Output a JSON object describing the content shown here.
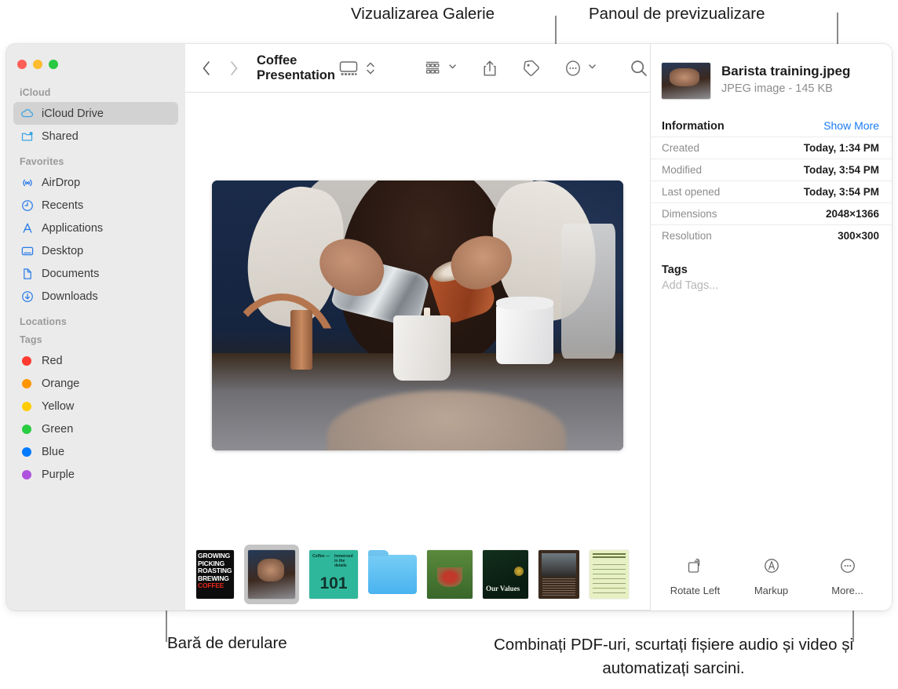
{
  "callouts": {
    "gallery_view": "Vizualizarea Galerie",
    "preview_panel": "Panoul de previzualizare",
    "scrollbar": "Bară de derulare",
    "more_actions": "Combinați PDF-uri, scurtați fișiere audio și video și automatizați sarcini."
  },
  "window": {
    "traffic_lights": [
      "close",
      "minimize",
      "zoom"
    ],
    "colors": {
      "close": "#ff5f57",
      "minimize": "#febc2e",
      "zoom": "#28c840",
      "accent": "#1a7cf5",
      "sidebar_bg": "#ebebeb",
      "selection": "#d2d2d2"
    }
  },
  "toolbar": {
    "back_label": "Back",
    "forward_label": "Forward",
    "title": "Coffee Presentation",
    "view_button": "gallery-view",
    "view_stepper": "view-options",
    "group_button": "group-by",
    "share_button": "Share",
    "tag_button": "Tags",
    "more_button": "More",
    "search_button": "Search"
  },
  "sidebar": {
    "sections": [
      {
        "label": "iCloud",
        "items": [
          {
            "label": "iCloud Drive",
            "icon": "cloud-icon",
            "selected": true
          },
          {
            "label": "Shared",
            "icon": "shared-folder-icon",
            "selected": false
          }
        ]
      },
      {
        "label": "Favorites",
        "items": [
          {
            "label": "AirDrop",
            "icon": "airdrop-icon",
            "selected": false
          },
          {
            "label": "Recents",
            "icon": "clock-icon",
            "selected": false
          },
          {
            "label": "Applications",
            "icon": "applications-icon",
            "selected": false
          },
          {
            "label": "Desktop",
            "icon": "desktop-icon",
            "selected": false
          },
          {
            "label": "Documents",
            "icon": "document-icon",
            "selected": false
          },
          {
            "label": "Downloads",
            "icon": "downloads-icon",
            "selected": false
          }
        ]
      },
      {
        "label": "Locations",
        "items": []
      },
      {
        "label": "Tags",
        "items": [
          {
            "label": "Red",
            "color": "#ff3b30"
          },
          {
            "label": "Orange",
            "color": "#ff9500"
          },
          {
            "label": "Yellow",
            "color": "#ffcc00"
          },
          {
            "label": "Green",
            "color": "#28cd41"
          },
          {
            "label": "Blue",
            "color": "#007aff"
          },
          {
            "label": "Purple",
            "color": "#af52de"
          }
        ]
      }
    ]
  },
  "gallery": {
    "hero_alt": "Barista pouring steamed milk and coffee into a to-go cup",
    "thumbnails": [
      {
        "name": "Growing Picking Roasting Brewing Coffee",
        "lines": [
          "GROWING",
          "PICKING",
          "ROASTING",
          "BREWING"
        ],
        "accent_line": "COFFEE",
        "selected": false
      },
      {
        "name": "Barista training.jpeg",
        "selected": true
      },
      {
        "name": "Coffee 101",
        "big_text": "101",
        "small_left": "Coffee —",
        "small_right": "Immersed in the details",
        "selected": false
      },
      {
        "name": "Folder",
        "selected": false
      },
      {
        "name": "Berries harvest",
        "selected": false
      },
      {
        "name": "Our Values",
        "caption": "Our Values",
        "selected": false
      },
      {
        "name": "Meeting notes",
        "selected": false
      },
      {
        "name": "Product form",
        "caption": "Product",
        "selected": false
      }
    ]
  },
  "preview": {
    "file_name": "Barista training.jpeg",
    "file_meta": "JPEG image - 145 KB",
    "information_title": "Information",
    "show_more": "Show More",
    "info_rows": [
      {
        "key": "Created",
        "value": "Today, 1:34 PM"
      },
      {
        "key": "Modified",
        "value": "Today, 3:54 PM"
      },
      {
        "key": "Last opened",
        "value": "Today, 3:54 PM"
      },
      {
        "key": "Dimensions",
        "value": "2048×1366"
      },
      {
        "key": "Resolution",
        "value": "300×300"
      }
    ],
    "tags_title": "Tags",
    "add_tags_placeholder": "Add Tags...",
    "actions": [
      {
        "label": "Rotate Left",
        "icon": "rotate-left-icon"
      },
      {
        "label": "Markup",
        "icon": "markup-icon"
      },
      {
        "label": "More...",
        "icon": "more-circle-icon"
      }
    ]
  }
}
